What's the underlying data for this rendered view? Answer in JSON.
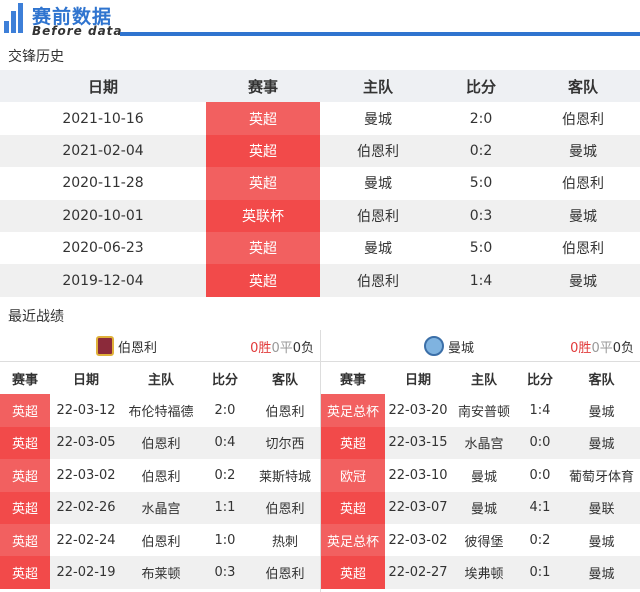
{
  "header": {
    "title": "赛前数据",
    "subtitle": "Before data",
    "accent": "#2f74cf"
  },
  "h2h": {
    "title": "交锋历史",
    "columns": [
      "日期",
      "赛事",
      "主队",
      "比分",
      "客队"
    ],
    "rows": [
      [
        "2021-10-16",
        "英超",
        "曼城",
        "2:0",
        "伯恩利"
      ],
      [
        "2021-02-04",
        "英超",
        "伯恩利",
        "0:2",
        "曼城"
      ],
      [
        "2020-11-28",
        "英超",
        "曼城",
        "5:0",
        "伯恩利"
      ],
      [
        "2020-10-01",
        "英联杯",
        "伯恩利",
        "0:3",
        "曼城"
      ],
      [
        "2020-06-23",
        "英超",
        "曼城",
        "5:0",
        "伯恩利"
      ],
      [
        "2019-12-04",
        "英超",
        "伯恩利",
        "1:4",
        "曼城"
      ]
    ]
  },
  "recent": {
    "title": "最近战绩",
    "columns": [
      "赛事",
      "日期",
      "主队",
      "比分",
      "客队"
    ],
    "left": {
      "team": "伯恩利",
      "crest_icon": "burnley-crest-icon",
      "record": {
        "w": "0胜",
        "d": "0平",
        "l": "0负"
      },
      "rows": [
        [
          "英超",
          "22-03-12",
          "布伦特福德",
          "2:0",
          "伯恩利"
        ],
        [
          "英超",
          "22-03-05",
          "伯恩利",
          "0:4",
          "切尔西"
        ],
        [
          "英超",
          "22-03-02",
          "伯恩利",
          "0:2",
          "莱斯特城"
        ],
        [
          "英超",
          "22-02-26",
          "水晶宫",
          "1:1",
          "伯恩利"
        ],
        [
          "英超",
          "22-02-24",
          "伯恩利",
          "1:0",
          "热刺"
        ],
        [
          "英超",
          "22-02-19",
          "布莱顿",
          "0:3",
          "伯恩利"
        ]
      ]
    },
    "right": {
      "team": "曼城",
      "crest_icon": "man-city-crest-icon",
      "record": {
        "w": "0胜",
        "d": "0平",
        "l": "0负"
      },
      "rows": [
        [
          "英足总杯",
          "22-03-20",
          "南安普顿",
          "1:4",
          "曼城"
        ],
        [
          "英超",
          "22-03-15",
          "水晶宫",
          "0:0",
          "曼城"
        ],
        [
          "欧冠",
          "22-03-10",
          "曼城",
          "0:0",
          "葡萄牙体育"
        ],
        [
          "英超",
          "22-03-07",
          "曼城",
          "4:1",
          "曼联"
        ],
        [
          "英足总杯",
          "22-03-02",
          "彼得堡",
          "0:2",
          "曼城"
        ],
        [
          "英超",
          "22-02-27",
          "埃弗顿",
          "0:1",
          "曼城"
        ]
      ]
    }
  },
  "colors": {
    "comp_badge": "#f24a4a",
    "win": "#e13a3a",
    "draw": "#999999"
  }
}
